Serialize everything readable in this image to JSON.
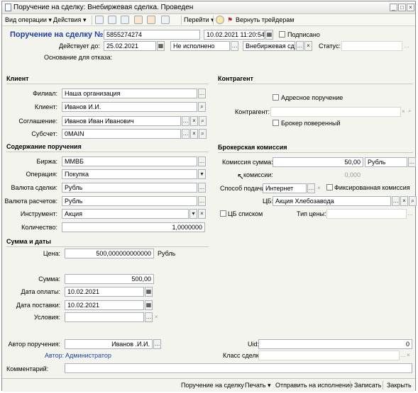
{
  "window": {
    "title": "Поручение на сделку: Внебиржевая сделка. Проведен",
    "controls": [
      "_",
      "□",
      "×"
    ]
  },
  "toolbar": {
    "operations": "Вид операции",
    "actions": "Действия",
    "goto": "Перейти",
    "return": "Вернуть трейдерам"
  },
  "header": {
    "title": "Поручение на сделку №",
    "number": "5855274274",
    "datetime": "10.02.2021 11:20:54",
    "signed_label": "Подписано",
    "valid_until_label": "Действует до:",
    "valid_until": "25.02.2021",
    "state": "Не исполнено",
    "deal_kind": "Внебиржевая сде",
    "status_label": "Статус:",
    "status_value": "",
    "refusal_label": "Основание для отказа:"
  },
  "client": {
    "section": "Клиент",
    "branch_label": "Филиал:",
    "branch": "Наша организация",
    "client_label": "Клиент:",
    "client": "Иванов И.И.",
    "agreement_label": "Соглашение:",
    "agreement": "Иванов Иван Иванович",
    "subaccount_label": "Субсчет:",
    "subaccount": "0MAIN"
  },
  "counterparty": {
    "section": "Контрагент",
    "address_order": "Адресное поручение",
    "cp_label": "Контрагент:",
    "cp_value": "",
    "trusted_broker": "Брокер поверенный"
  },
  "content": {
    "section": "Содержание поручения",
    "exchange_label": "Биржа:",
    "exchange": "ММВБ",
    "operation_label": "Операция:",
    "operation": "Покупка",
    "deal_currency_label": "Валюта сделки:",
    "deal_currency": "Рубль",
    "settle_currency_label": "Валюта расчетов:",
    "settle_currency": "Рубль",
    "instrument_label": "Инструмент:",
    "instrument": "Акция",
    "quantity_label": "Количество:",
    "quantity": "1,0000000"
  },
  "commission": {
    "section": "Брокерская комиссия",
    "sum_label": "Комиссия сумма:",
    "sum": "50,00",
    "sum_currency": "Рубль",
    "pct_label": "комиссии:",
    "pct_value": "0,000",
    "channel_label": "Способ подачи:",
    "channel": "Интернет",
    "fixed": "Фиксированная комиссия",
    "security_label": "ЦБ:",
    "security": "Акция Хлебозавода",
    "list_label": "ЦБ списком",
    "price_type_label": "Тип цены:",
    "price_type": ""
  },
  "amounts": {
    "section": "Сумма и даты",
    "price_label": "Цена:",
    "price": "500,000000000000",
    "price_currency": "Рубль",
    "amount_label": "Сумма:",
    "amount": "500,00",
    "pay_date_label": "Дата оплаты:",
    "pay_date": "10.02.2021",
    "delivery_date_label": "Дата поставки:",
    "delivery_date": "10.02.2021",
    "terms_label": "Условия:",
    "terms": ""
  },
  "footer": {
    "author_label": "Автор поручения:",
    "author": "Иванов .И.И.",
    "uid_label": "Uid:",
    "uid": "0",
    "author2_label": "Автор:",
    "author2": "Администратор",
    "deal_class_label": "Класс сделки:",
    "deal_class": "",
    "comment_label": "Комментарий:",
    "comment": ""
  },
  "bottom": {
    "order": "Поручение на сделку",
    "print": "Печать",
    "send": "Отправить на исполнение",
    "save": "Записать",
    "close": "Закрыть"
  }
}
